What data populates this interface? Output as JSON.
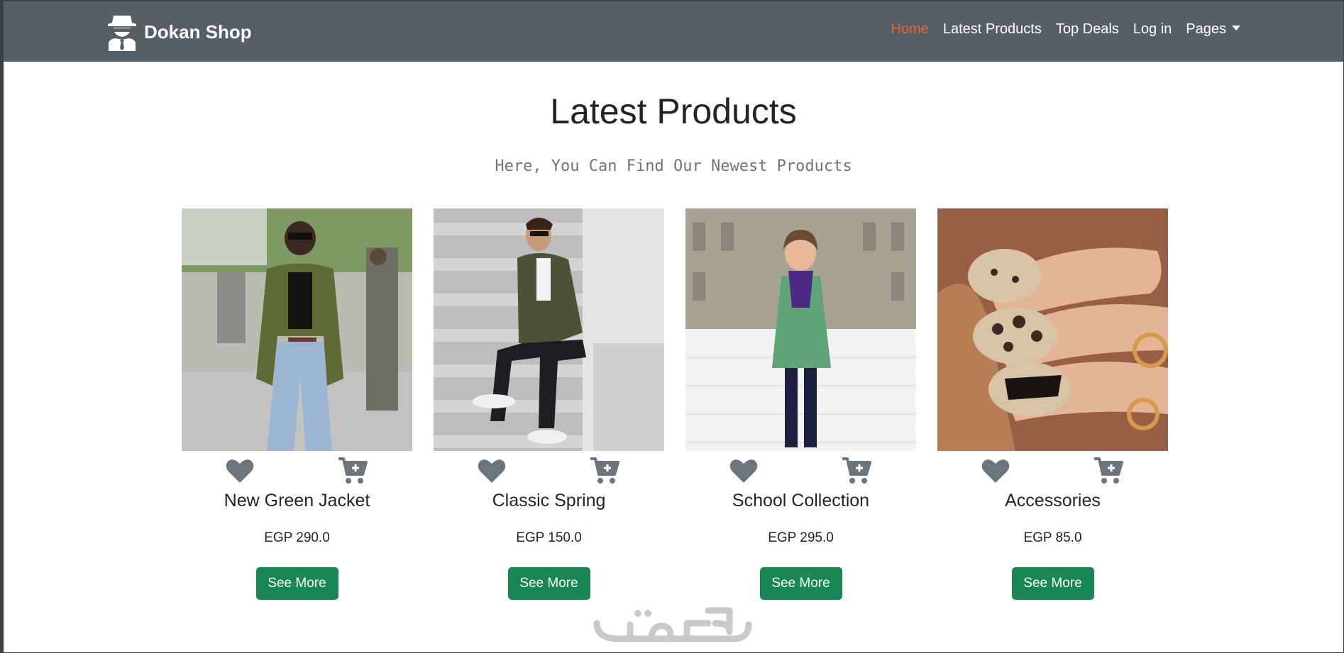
{
  "navbar": {
    "brand": "Dokan Shop",
    "brand_icon": "spy-icon",
    "links": [
      {
        "label": "Home",
        "active": true
      },
      {
        "label": "Latest Products",
        "active": false
      },
      {
        "label": "Top Deals",
        "active": false
      },
      {
        "label": "Log in",
        "active": false
      },
      {
        "label": "Pages",
        "active": false,
        "dropdown": true
      }
    ],
    "background": "#565e66",
    "active_color": "#e8633a"
  },
  "main": {
    "title": "Latest Products",
    "subtitle": "Here, You Can Find Our Newest Products"
  },
  "products": [
    {
      "name": "New Green Jacket",
      "price": "EGP 290.0",
      "button": "See More",
      "image": "woman-green-jacket-photo"
    },
    {
      "name": "Classic Spring",
      "price": "EGP 150.0",
      "button": "See More",
      "image": "man-camo-jacket-stairs-photo"
    },
    {
      "name": "School Collection",
      "price": "EGP 295.0",
      "button": "See More",
      "image": "girl-green-coat-photo"
    },
    {
      "name": "Accessories",
      "price": "EGP 85.0",
      "button": "See More",
      "image": "gold-nails-photo"
    }
  ],
  "icons": {
    "favorite": "heart-icon",
    "cart": "cart-plus-icon"
  },
  "colors": {
    "button": "#198754",
    "icon": "#6c757d"
  },
  "watermark": "خمسات"
}
